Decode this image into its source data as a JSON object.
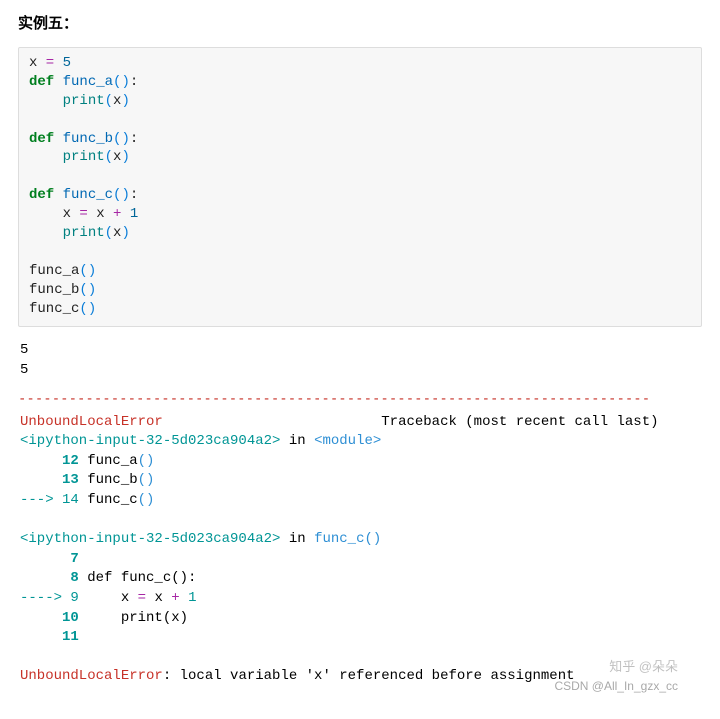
{
  "heading": "实例五：",
  "code": {
    "l1_x": "x",
    "l1_eq": " = ",
    "l1_5": "5",
    "def": "def",
    "fa": "func_a",
    "fb": "func_b",
    "fc": "func_c",
    "lp": "(",
    "rp": ")",
    "colon": ":",
    "print": "print",
    "x": "x",
    "assign": " = ",
    "plus": " + ",
    "one": "1"
  },
  "calls": {
    "fa": "func_a",
    "fb": "func_b",
    "fc": "func_c",
    "lp": "(",
    "rp": ")"
  },
  "output_plain": "5\n5",
  "dash": "---------------------------------------------------------------------------",
  "tb": {
    "err": "UnboundLocalError",
    "trace_label": "Traceback (most recent call last)",
    "src1_a": "<ipython-input-32-5d023ca904a2>",
    "in": " in ",
    "module": "<module>",
    "n12": "     12 ",
    "c12a": "func_a",
    "lp": "(",
    "rp": ")",
    "n13": "     13 ",
    "c13a": "func_b",
    "arrow14": "---> 14 ",
    "c14a": "func_c",
    "blank": "",
    "src2_a": "<ipython-input-32-5d023ca904a2>",
    "func_c_sig_a": "func_c",
    "func_c_sig_b": "()",
    "n7": "      7 ",
    "n8": "      8 ",
    "c8": "def func_c():",
    "arrow9": "----> 9 ",
    "c9_pre": "    x ",
    "c9_eq": "=",
    "c9_mid": " x ",
    "c9_plus": "+",
    "c9_sp": " ",
    "c9_one": "1",
    "n10": "     10 ",
    "c10_pre": "    print",
    "c10_x": "(x)",
    "n11": "     11 ",
    "final_a": "UnboundLocalError",
    "final_b": ": local variable 'x' referenced before assignment"
  },
  "watermark1": "知乎 @朵朵",
  "watermark2": "CSDN @All_In_gzx_cc"
}
